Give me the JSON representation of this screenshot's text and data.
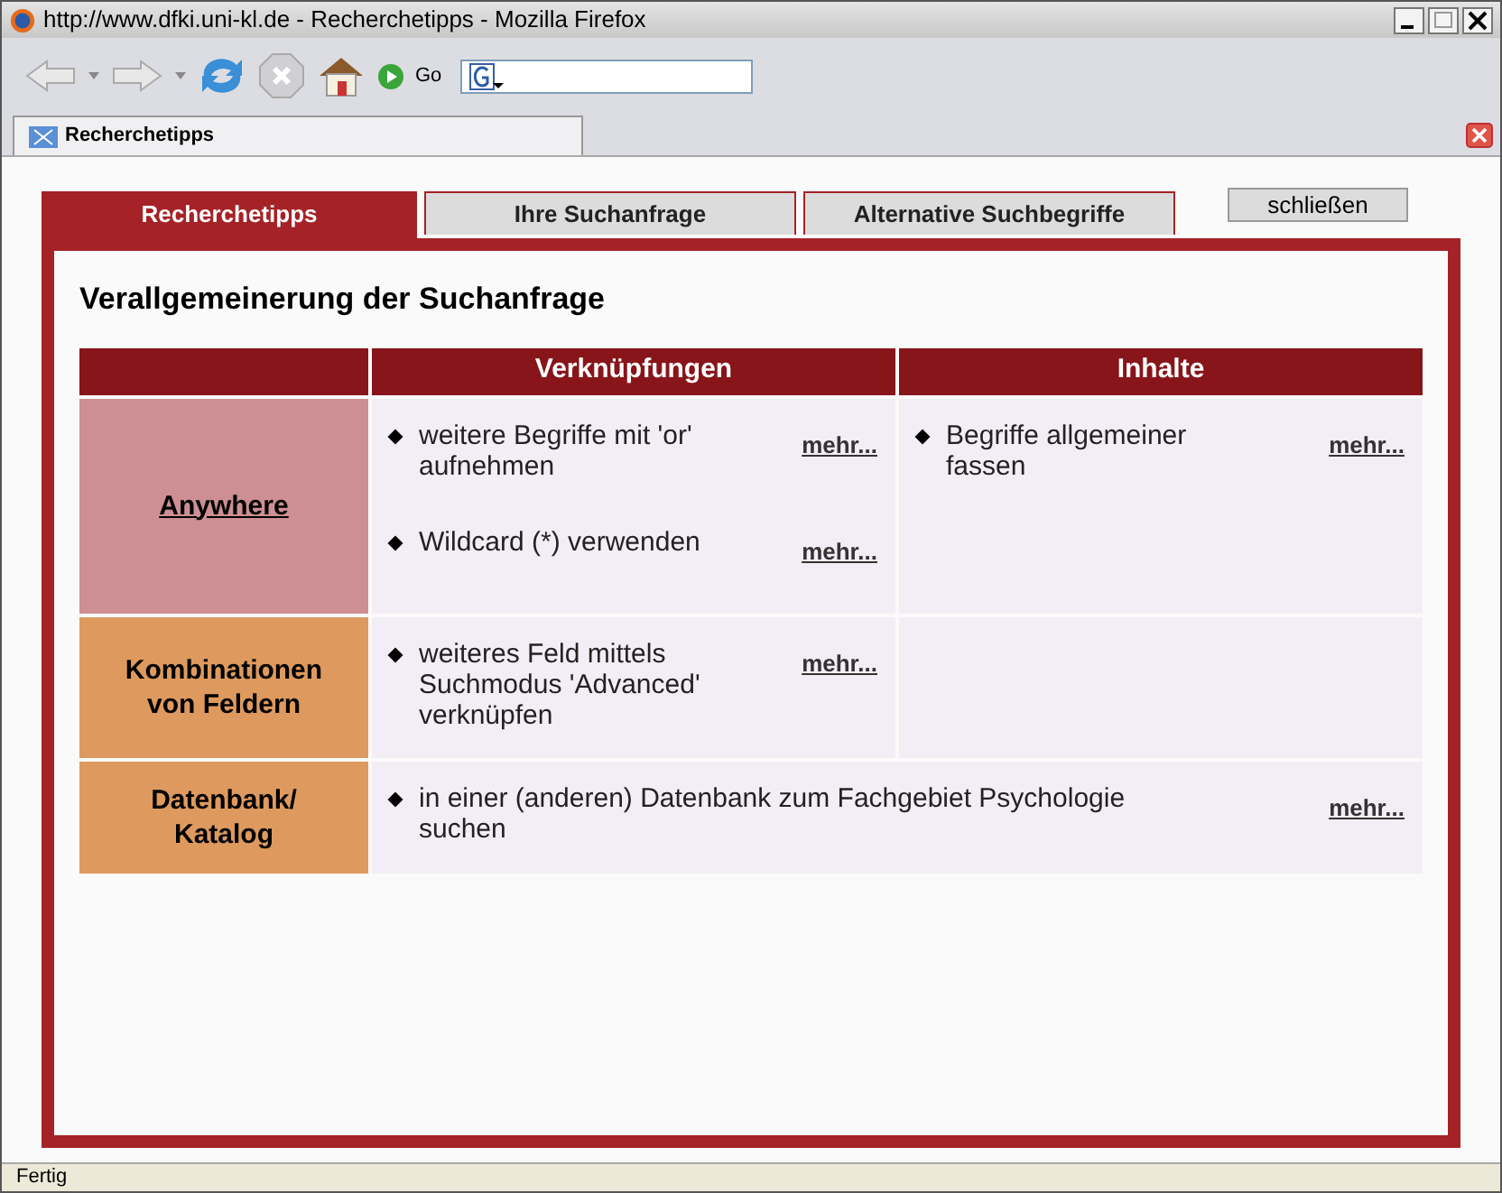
{
  "window": {
    "title": "http://www.dfki.uni-kl.de - Recherchetipps - Mozilla Firefox"
  },
  "toolbar": {
    "go_label": "Go"
  },
  "browser_tabs": [
    {
      "label": "Recherchetipps",
      "selected": true
    }
  ],
  "tabs": [
    {
      "label": "Recherchetipps",
      "selected": true
    },
    {
      "label": "Ihre Suchanfrage",
      "selected": false
    },
    {
      "label": "Alternative Suchbegriffe",
      "selected": false
    }
  ],
  "close_button": "schließen",
  "heading": "Verallgemeinerung der Suchanfrage",
  "table": {
    "columns": [
      "Verknüpfungen",
      "Inhalte"
    ],
    "rows": [
      {
        "label": "Anywhere",
        "linked": true,
        "color": "#cd8f93",
        "cells": [
          {
            "items": [
              {
                "text": "weitere Begriffe mit 'or' aufnehmen",
                "link": "mehr..."
              },
              {
                "text": "Wildcard (*) verwenden",
                "link": "mehr..."
              }
            ]
          },
          {
            "items": [
              {
                "text": "Begriffe allgemeiner fassen",
                "link": "mehr..."
              }
            ]
          }
        ]
      },
      {
        "label": "Kombinationen von Feldern",
        "linked": false,
        "color": "#de9a5e",
        "cells": [
          {
            "items": [
              {
                "text": "weiteres Feld mittels Suchmodus 'Advanced' verknüpfen",
                "link": "mehr..."
              }
            ]
          }
        ]
      },
      {
        "label": "Datenbank/ Katalog",
        "linked": false,
        "color": "#de9a5e",
        "cells": [
          {
            "wide": true,
            "items": [
              {
                "text": "in einer (anderen) Datenbank zum Fachgebiet Psychologie suchen",
                "link": "mehr..."
              }
            ]
          }
        ]
      }
    ]
  },
  "status_bar": "Fertig"
}
